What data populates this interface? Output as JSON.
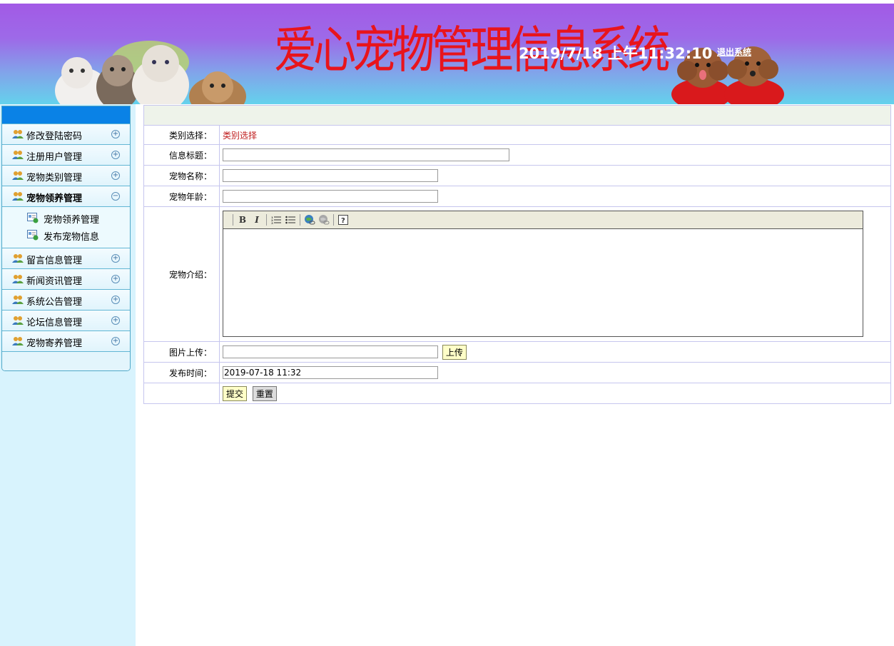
{
  "header": {
    "title": "爱心宠物管理信息系统",
    "clock": "2019/7/18 上午11:32:10",
    "logout_label": "退出系统"
  },
  "sidebar": {
    "items": [
      {
        "label": "修改登陆密码",
        "icon": "users-icon",
        "toggle": "expand-icon"
      },
      {
        "label": "注册用户管理",
        "icon": "users-icon",
        "toggle": "expand-icon"
      },
      {
        "label": "宠物类别管理",
        "icon": "users-icon",
        "toggle": "expand-icon"
      },
      {
        "label": "宠物领养管理",
        "icon": "users-icon",
        "toggle": "collapse-icon",
        "expanded": true,
        "children": [
          {
            "label": "宠物领养管理",
            "icon": "doc-icon"
          },
          {
            "label": "发布宠物信息",
            "icon": "doc-icon"
          }
        ]
      },
      {
        "label": "留言信息管理",
        "icon": "users-icon",
        "toggle": "expand-icon"
      },
      {
        "label": "新闻资讯管理",
        "icon": "users-icon",
        "toggle": "expand-icon"
      },
      {
        "label": "系统公告管理",
        "icon": "users-icon",
        "toggle": "expand-icon"
      },
      {
        "label": "论坛信息管理",
        "icon": "users-icon",
        "toggle": "expand-icon"
      },
      {
        "label": "宠物寄养管理",
        "icon": "users-icon",
        "toggle": "expand-icon"
      }
    ]
  },
  "form": {
    "category_label": "类别选择：",
    "category_value": "类别选择",
    "title_label": "信息标题：",
    "title_value": "",
    "pet_name_label": "宠物名称：",
    "pet_name_value": "",
    "pet_age_label": "宠物年龄：",
    "pet_age_value": "",
    "intro_label": "宠物介绍：",
    "image_label": "图片上传：",
    "image_value": "",
    "upload_button": "上传",
    "publish_time_label": "发布时间：",
    "publish_time_value": "2019-07-18 11:32",
    "submit_button": "提交",
    "reset_button": "重置"
  },
  "editor_toolbar": [
    "bold-icon",
    "italic-icon",
    "ordered-list-icon",
    "unordered-list-icon",
    "link-icon",
    "unlink-icon",
    "help-icon"
  ],
  "colors": {
    "title_red": "#e8141c",
    "menu_head": "#0a82e6",
    "sidebar_bg": "#d8f3fd",
    "button_yellow": "#ffffc8"
  }
}
